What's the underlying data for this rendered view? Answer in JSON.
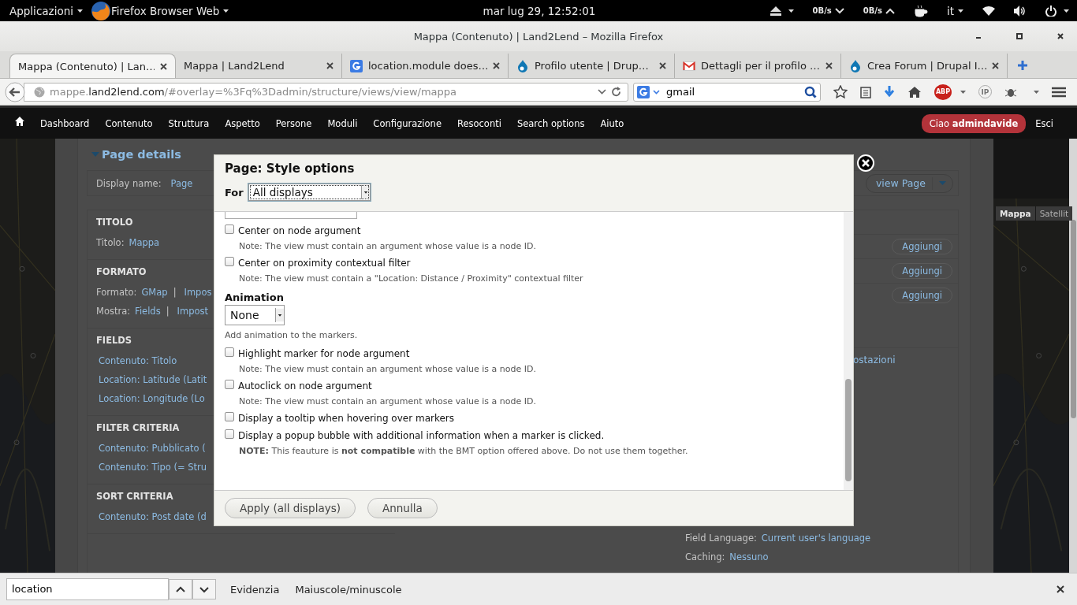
{
  "top_bar": {
    "activities": "Applicazioni",
    "app_menu": "Firefox Browser Web",
    "clock": "mar lug 29, 12:52:01",
    "net_down": "0B/s",
    "net_up": "0B/s",
    "keyboard_layout": "it"
  },
  "window": {
    "title": "Mappa (Contenuto) | Land2Lend – Mozilla Firefox"
  },
  "tabs": [
    {
      "label": "Mappa (Contenuto) | Lan…",
      "kind": "plain",
      "selected": true
    },
    {
      "label": "Mappa | Land2Lend",
      "kind": "plain",
      "selected": false
    },
    {
      "label": "location.module does…",
      "kind": "google",
      "selected": false
    },
    {
      "label": "Profilo utente | Drup…",
      "kind": "drupal",
      "selected": false
    },
    {
      "label": "Dettagli per il profilo …",
      "kind": "gmail",
      "selected": false
    },
    {
      "label": "Crea Forum | Drupal I…",
      "kind": "drupal",
      "selected": false
    }
  ],
  "nav": {
    "url": {
      "subdomain": "mappe.",
      "domain": "land2lend.com",
      "path": "/#overlay=%3Fq%3Dadmin/structure/views/view/mappa"
    },
    "search": "gmail",
    "addon_badges": [
      "ABP",
      "IP"
    ]
  },
  "admin_toolbar": {
    "items": [
      "Dashboard",
      "Contenuto",
      "Struttura",
      "Aspetto",
      "Persone",
      "Moduli",
      "Configurazione",
      "Resoconti",
      "Search options",
      "Aiuto"
    ],
    "greeting": "Ciao **admindavide**",
    "logout": "Esci"
  },
  "view_page": {
    "section_title": "Page details",
    "display_name_label": "Display name:",
    "display_name": "Page",
    "view_button": "view Page",
    "left_sections": [
      {
        "heading": "TITOLO",
        "rows": [
          [
            {
              "kind": "label",
              "text": "Titolo:"
            },
            {
              "kind": "link",
              "text": "Mappa"
            }
          ]
        ]
      },
      {
        "heading": "FORMATO",
        "rows": [
          [
            {
              "kind": "label",
              "text": "Formato:"
            },
            {
              "kind": "link",
              "text": "GMap"
            },
            {
              "kind": "sep",
              "text": "|"
            },
            {
              "kind": "link",
              "text": "Impos"
            }
          ],
          [
            {
              "kind": "label",
              "text": "Mostra:"
            },
            {
              "kind": "link",
              "text": "Fields"
            },
            {
              "kind": "sep",
              "text": "|"
            },
            {
              "kind": "link",
              "text": "Impost"
            }
          ]
        ]
      },
      {
        "heading": "FIELDS",
        "rows": [
          [
            {
              "kind": "item",
              "text": "Contenuto: Titolo"
            }
          ],
          [
            {
              "kind": "item",
              "text": "Location: Latitude (Latit"
            }
          ],
          [
            {
              "kind": "item",
              "text": "Location: Longitude (Lo"
            }
          ]
        ]
      },
      {
        "heading": "FILTER CRITERIA",
        "rows": [
          [
            {
              "kind": "item",
              "text": "Contenuto: Pubblicato ("
            }
          ],
          [
            {
              "kind": "item",
              "text": "Contenuto: Tipo (= Stru"
            }
          ]
        ]
      },
      {
        "heading": "SORT CRITERIA",
        "rows": [
          [
            {
              "kind": "item",
              "text": "Contenuto: Post date (d"
            }
          ]
        ]
      }
    ],
    "right_rows": [
      {
        "kind": "add",
        "text": "Aggiungi"
      },
      {
        "kind": "add",
        "text": "Aggiungi"
      },
      {
        "kind": "add",
        "text": "Aggiungi"
      },
      {
        "kind": "tail",
        "text": "ostazioni"
      },
      {
        "kind": "setting",
        "label": "Field Language:",
        "value": "Current user's language"
      },
      {
        "kind": "setting",
        "label": "Caching:",
        "value": "Nessuno"
      }
    ]
  },
  "map": {
    "controls": [
      {
        "label": "Mappa",
        "selected": true
      },
      {
        "label": "Satellit",
        "selected": false
      }
    ]
  },
  "dialog": {
    "title": "Page: Style options",
    "for_label": "For",
    "for_value": "All displays",
    "options": [
      {
        "kind": "checkbox",
        "label": "Center on node argument",
        "checked": false,
        "note": "Note: The view must contain an argument whose value is a node ID."
      },
      {
        "kind": "checkbox",
        "label": "Center on proximity contextual filter",
        "checked": false,
        "note": "Note: The view must contain a \"Location: Distance / Proximity\" contextual filter"
      },
      {
        "kind": "select",
        "label": "Animation",
        "value": "None",
        "description": "Add animation to the markers."
      },
      {
        "kind": "checkbox",
        "label": "Highlight marker for node argument",
        "checked": false,
        "note": "Note: The view must contain an argument whose value is a node ID."
      },
      {
        "kind": "checkbox",
        "label": "Autoclick on node argument",
        "checked": false,
        "note": "Note: The view must contain an argument whose value is a node ID."
      },
      {
        "kind": "checkbox",
        "label": "Display a tooltip when hovering over markers",
        "checked": false
      },
      {
        "kind": "checkbox",
        "label": "Display a popup bubble with additional information when a marker is clicked.",
        "checked": false,
        "note": "**NOTE:** This feauture is **not compatible** with the BMT option offered above. Do not use them together."
      }
    ],
    "buttons": [
      "Apply (all displays)",
      "Annulla"
    ]
  },
  "find_bar": {
    "value": "location",
    "highlight": "Evidenzia",
    "match_case": "Maiuscole/minuscole"
  }
}
